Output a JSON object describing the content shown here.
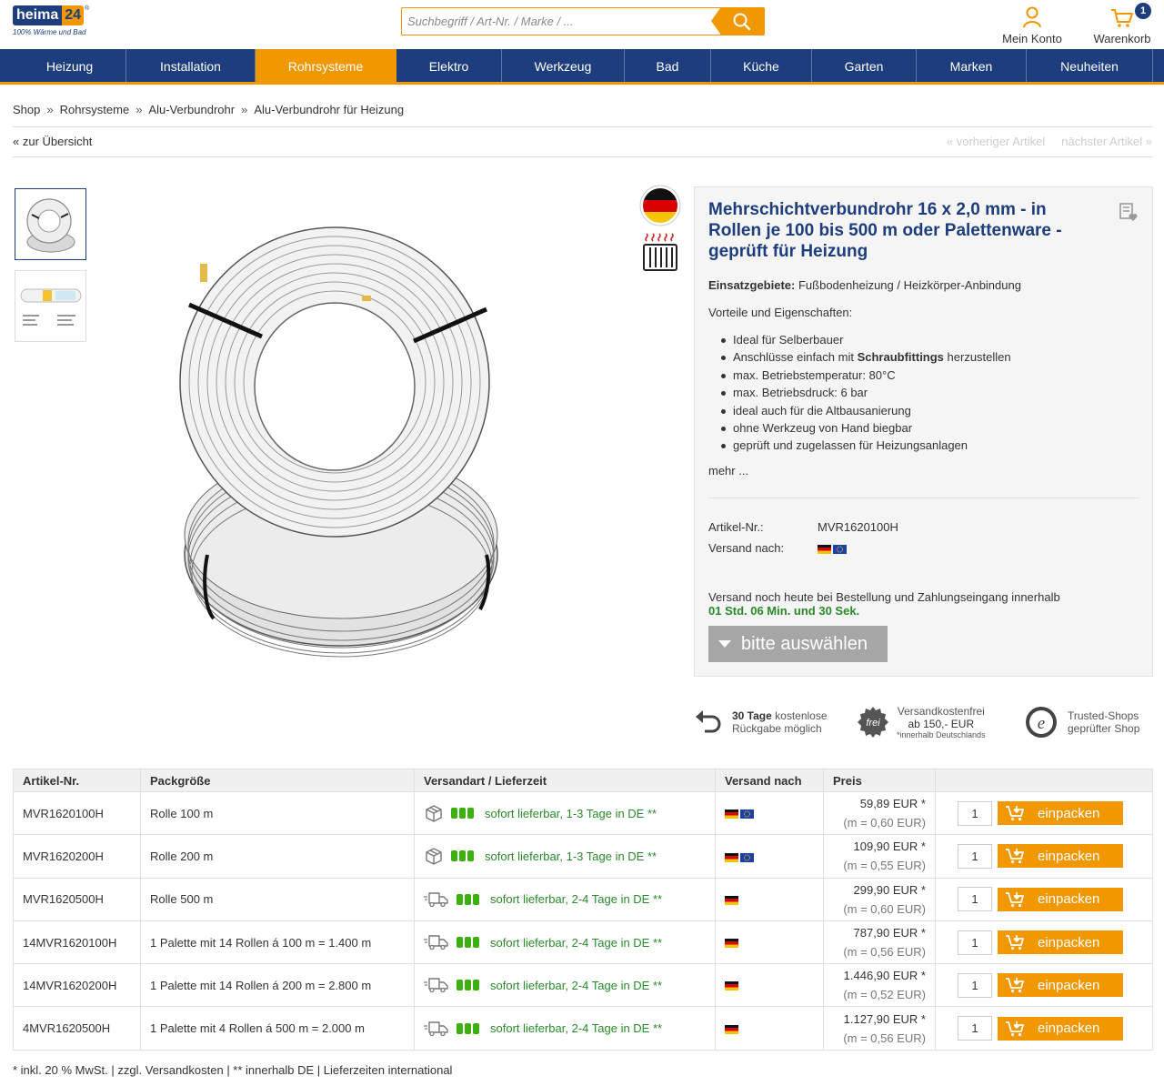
{
  "header": {
    "logo_text_a": "heima",
    "logo_text_b": "24",
    "logo_tagline": "100% Wärme und Bad",
    "search_placeholder": "Suchbegriff / Art-Nr. / Marke / ...",
    "account_label": "Mein Konto",
    "cart_label": "Warenkorb",
    "cart_count": "1"
  },
  "nav": {
    "items": [
      {
        "label": "Heizung",
        "active": false
      },
      {
        "label": "Installation",
        "active": false
      },
      {
        "label": "Rohrsysteme",
        "active": true
      },
      {
        "label": "Elektro",
        "active": false
      },
      {
        "label": "Werkzeug",
        "active": false
      },
      {
        "label": "Bad",
        "active": false
      },
      {
        "label": "Küche",
        "active": false
      },
      {
        "label": "Garten",
        "active": false
      },
      {
        "label": "Marken",
        "active": false
      },
      {
        "label": "Neuheiten",
        "active": false
      }
    ]
  },
  "breadcrumb": {
    "items": [
      "Shop",
      "Rohrsysteme",
      "Alu-Verbundrohr",
      "Alu-Verbundrohr für Heizung"
    ],
    "separator": "»"
  },
  "pager": {
    "back": "« zur Übersicht",
    "prev": "« vorheriger Artikel",
    "next": "nächster Artikel »"
  },
  "product": {
    "title": "Mehrschichtverbundrohr 16 x 2,0 mm - in Rollen je 100 bis 500 m oder Palettenware - geprüft für Heizung",
    "usage_label": "Einsatzgebiete:",
    "usage_value": " Fußbodenheizung / Heizkörper-Anbindung",
    "advantages_heading": "Vorteile und Eigenschaften:",
    "features": [
      "Ideal für Selberbauer",
      "Anschlüsse einfach mit ",
      "max. Betriebstemperatur: 80°C",
      "max. Betriebsdruck: 6 bar",
      "ideal auch für die Altbausanierung",
      "ohne Werkzeug von Hand biegbar",
      "geprüft und zugelassen für Heizungsanlagen"
    ],
    "feature2_bold": "Schraubfittings",
    "feature2_tail": " herzustellen",
    "more": "mehr ...",
    "article_label": "Artikel-Nr.:",
    "article_value": "MVR1620100H",
    "ship_label": "Versand nach:",
    "ship_text": "Versand noch heute bei Bestellung und Zahlungseingang innerhalb",
    "ship_time": "01 Std. 06 Min. und 30 Sek.",
    "select_label": "bitte auswählen"
  },
  "trust": {
    "return_bold": "30 Tage",
    "return_rest": " kostenlose",
    "return_line2": "Rückgabe möglich",
    "free_badge": "frei",
    "free_line1": "Versandkostenfrei",
    "free_line2": "ab 150,- EUR",
    "free_line3": "*innerhalb Deutschlands",
    "ts_line1": "Trusted-Shops",
    "ts_line2": "geprüfter Shop"
  },
  "table": {
    "headers": [
      "Artikel-Nr.",
      "Packgröße",
      "Versandart / Lieferzeit",
      "Versand nach",
      "Preis",
      ""
    ],
    "rows": [
      {
        "sku": "MVR1620100H",
        "pack": "Rolle 100 m",
        "avail": "sofort lieferbar, 1-3 Tage in DE **",
        "ship": "parcel",
        "eu": true,
        "price": "59,89 EUR *",
        "unit": "(m = 0,60 EUR)",
        "qty": "1"
      },
      {
        "sku": "MVR1620200H",
        "pack": "Rolle 200 m",
        "avail": "sofort lieferbar, 1-3 Tage in DE **",
        "ship": "parcel",
        "eu": true,
        "price": "109,90 EUR *",
        "unit": "(m = 0,55 EUR)",
        "qty": "1"
      },
      {
        "sku": "MVR1620500H",
        "pack": "Rolle 500 m",
        "avail": "sofort lieferbar, 2-4 Tage in DE **",
        "ship": "truck",
        "eu": false,
        "price": "299,90 EUR *",
        "unit": "(m = 0,60 EUR)",
        "qty": "1"
      },
      {
        "sku": "14MVR1620100H",
        "pack": "1 Palette mit 14 Rollen á 100 m = 1.400 m",
        "avail": "sofort lieferbar, 2-4 Tage in DE **",
        "ship": "truck",
        "eu": false,
        "price": "787,90 EUR *",
        "unit": "(m = 0,56 EUR)",
        "qty": "1"
      },
      {
        "sku": "14MVR1620200H",
        "pack": "1 Palette mit 14 Rollen á 200 m = 2.800 m",
        "avail": "sofort lieferbar, 2-4 Tage in DE **",
        "ship": "truck",
        "eu": false,
        "price": "1.446,90 EUR *",
        "unit": "(m = 0,52 EUR)",
        "qty": "1"
      },
      {
        "sku": "4MVR1620500H",
        "pack": "1 Palette mit 4 Rollen á 500 m = 2.000 m",
        "avail": "sofort lieferbar, 2-4 Tage in DE **",
        "ship": "truck",
        "eu": false,
        "price": "1.127,90 EUR *",
        "unit": "(m = 0,56 EUR)",
        "qty": "1"
      }
    ],
    "cart_button": "einpacken"
  },
  "footnote": "* inkl. 20 % MwSt. | zzgl. Versandkosten | ** innerhalb DE | Lieferzeiten international",
  "colors": {
    "brand_blue": "#1d3d7c",
    "accent_orange": "#f19700",
    "available_green": "#2a8a2a"
  }
}
